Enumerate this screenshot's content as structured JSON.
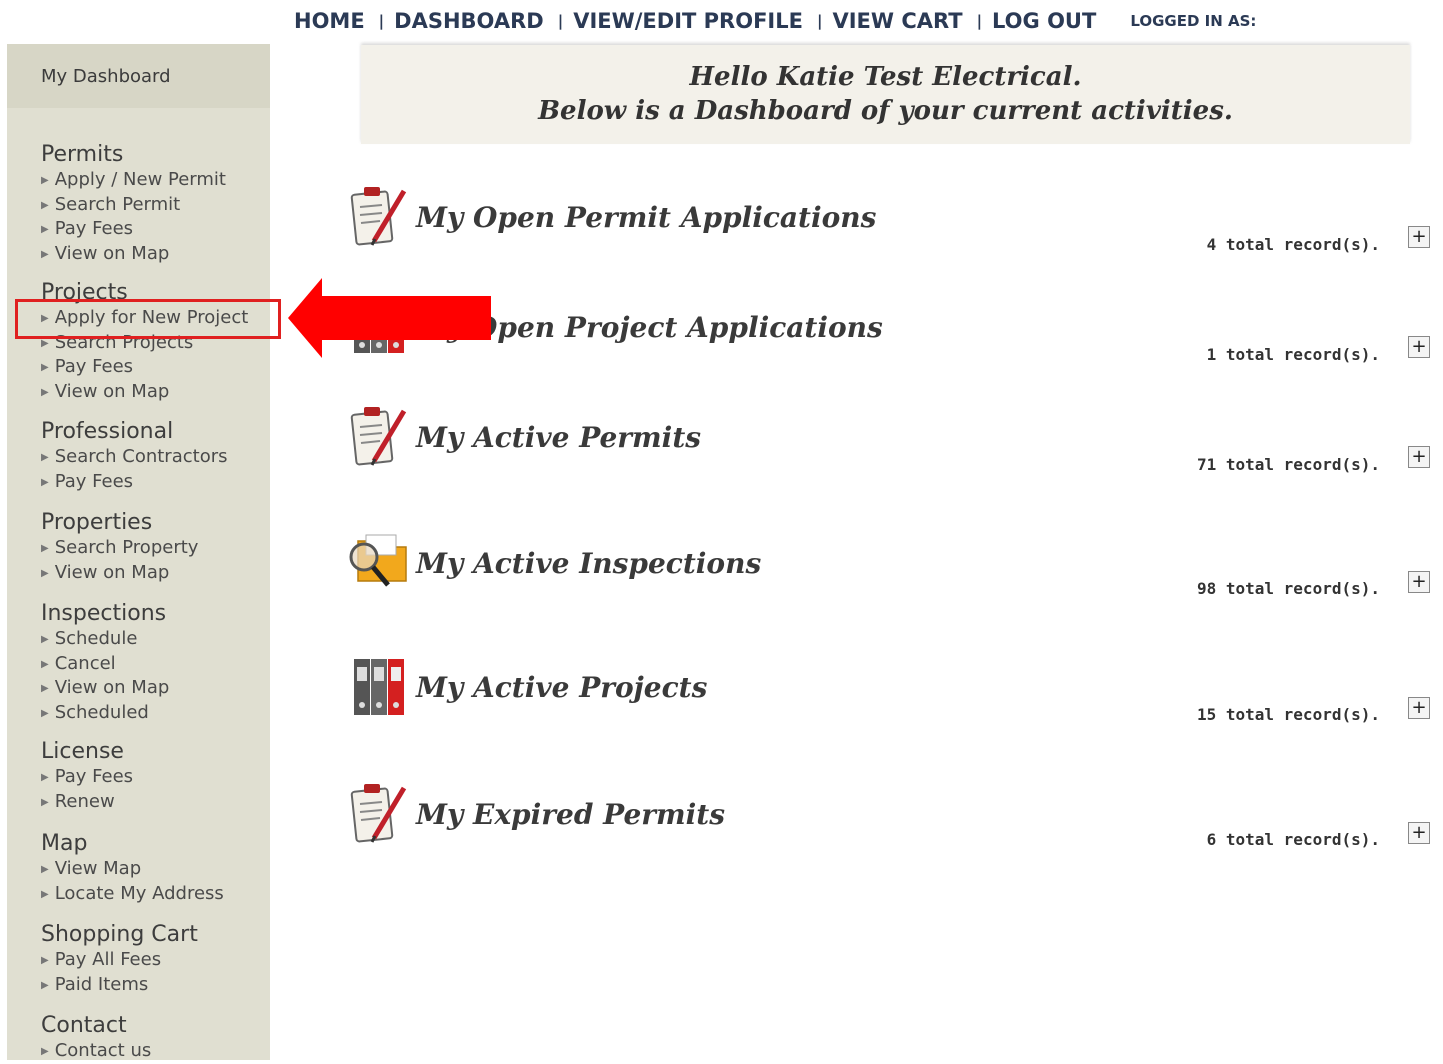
{
  "topnav": {
    "home": "HOME",
    "dashboard": "DASHBOARD",
    "profile": "VIEW/EDIT PROFILE",
    "cart": "VIEW CART",
    "logout": "LOG OUT",
    "separator": "|",
    "logged_in_label": "LOGGED IN AS:"
  },
  "sidebar": {
    "header": "My Dashboard",
    "groups": [
      {
        "title": "Permits",
        "items": [
          "Apply / New Permit",
          "Search Permit",
          "Pay Fees",
          "View on Map"
        ]
      },
      {
        "title": "Projects",
        "items": [
          "Apply for New Project",
          "Search Projects",
          "Pay Fees",
          "View on Map"
        ]
      },
      {
        "title": "Professional",
        "items": [
          "Search Contractors",
          "Pay Fees"
        ]
      },
      {
        "title": "Properties",
        "items": [
          "Search Property",
          "View on Map"
        ]
      },
      {
        "title": "Inspections",
        "items": [
          "Schedule",
          "Cancel",
          "View on Map",
          "Scheduled"
        ]
      },
      {
        "title": "License",
        "items": [
          "Pay Fees",
          "Renew"
        ]
      },
      {
        "title": "Map",
        "items": [
          "View Map",
          "Locate My Address"
        ]
      },
      {
        "title": "Shopping Cart",
        "items": [
          "Pay All Fees",
          "Paid Items"
        ]
      },
      {
        "title": "Contact",
        "items": [
          "Contact us"
        ]
      }
    ]
  },
  "banner": {
    "line1": "Hello Katie Test Electrical.",
    "line2": "Below is a Dashboard of your current activities."
  },
  "records": [
    {
      "title": "My Open Permit Applications",
      "count": "4 total record(s).",
      "icon": "clipboard-pencil-icon"
    },
    {
      "title": "My Open Project Applications",
      "count": "1 total record(s).",
      "icon": "binders-icon"
    },
    {
      "title": "My Active Permits",
      "count": "71 total record(s).",
      "icon": "clipboard-pencil-icon"
    },
    {
      "title": "My Active Inspections",
      "count": "98 total record(s).",
      "icon": "folder-magnifier-icon"
    },
    {
      "title": "My Active Projects",
      "count": "15 total record(s).",
      "icon": "binders-icon"
    },
    {
      "title": "My Expired Permits",
      "count": "6 total record(s).",
      "icon": "clipboard-pencil-icon"
    }
  ],
  "expand_symbol": "+",
  "colors": {
    "nav_text": "#2b3a55",
    "sidebar_bg": "#e0dfd1",
    "banner_bg": "#f3f1ea",
    "highlight": "#e02020"
  }
}
